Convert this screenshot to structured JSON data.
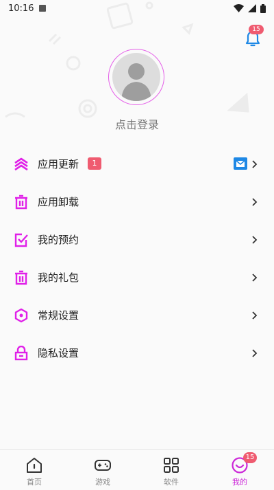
{
  "status_bar": {
    "time": "10:16"
  },
  "notifications": {
    "badge_count": "15"
  },
  "profile": {
    "login_label": "点击登录"
  },
  "menu": {
    "items": [
      {
        "label": "应用更新",
        "badge": "1"
      },
      {
        "label": "应用卸载"
      },
      {
        "label": "我的预约"
      },
      {
        "label": "我的礼包"
      },
      {
        "label": "常规设置"
      },
      {
        "label": "隐私设置"
      }
    ]
  },
  "tabs": [
    {
      "label": "首页"
    },
    {
      "label": "游戏"
    },
    {
      "label": "软件"
    },
    {
      "label": "我的",
      "badge": "15",
      "active": true
    }
  ],
  "colors": {
    "accent": "#e020e8",
    "badge": "#ef5b70",
    "bell": "#1e88e5"
  }
}
